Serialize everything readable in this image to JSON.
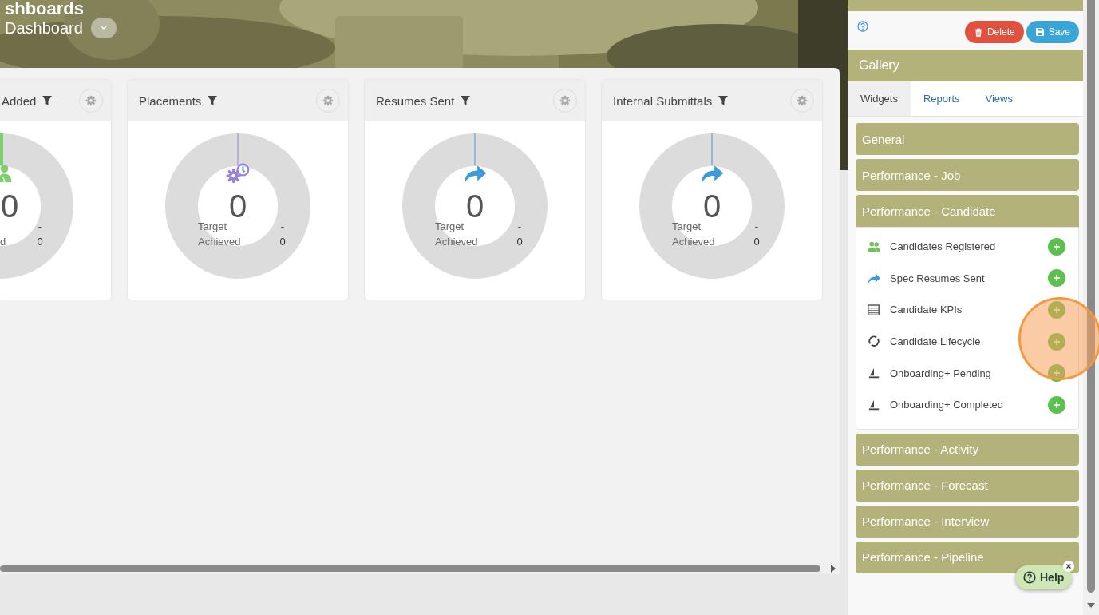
{
  "header": {
    "title": "shboards",
    "dashboard_name": "Dashboard"
  },
  "widgets": [
    {
      "title": "Added",
      "kind": "people",
      "color": "#7ccf6b",
      "value": "0",
      "target_value": "-",
      "achieved_label": "d",
      "achieved_value": "0",
      "partial": true
    },
    {
      "title": "Placements",
      "kind": "gear-clock",
      "color": "#9b7fdc",
      "value": "0",
      "target_label": "Target",
      "target_value": "-",
      "achieved_label": "Achieved",
      "achieved_value": "0",
      "partial": false
    },
    {
      "title": "Resumes Sent",
      "kind": "share-arrow",
      "color": "#3d9ad9",
      "value": "0",
      "target_label": "Target",
      "target_value": "-",
      "achieved_label": "Achieved",
      "achieved_value": "0",
      "partial": false
    },
    {
      "title": "Internal Submittals",
      "kind": "share-arrow",
      "color": "#3d9ad9",
      "value": "0",
      "target_label": "Target",
      "target_value": "-",
      "achieved_label": "Achieved",
      "achieved_value": "0",
      "partial": false
    }
  ],
  "side_panel": {
    "delete_button": "Delete",
    "save_button": "Save",
    "gallery_title": "Gallery",
    "tabs": [
      {
        "label": "Widgets",
        "selected": true
      },
      {
        "label": "Reports",
        "selected": false
      },
      {
        "label": "Views",
        "selected": false
      }
    ],
    "sections": [
      {
        "title": "General",
        "expanded": false
      },
      {
        "title": "Performance - Job",
        "expanded": false
      },
      {
        "title": "Performance - Candidate",
        "expanded": true,
        "items": [
          {
            "label": "Candidates Registered",
            "kind": "people"
          },
          {
            "label": "Spec Resumes Sent",
            "kind": "share-arrow"
          },
          {
            "label": "Candidate KPIs",
            "kind": "table"
          },
          {
            "label": "Candidate Lifecycle",
            "kind": "cycle"
          },
          {
            "label": "Onboarding+ Pending",
            "kind": "sailboat"
          },
          {
            "label": "Onboarding+ Completed",
            "kind": "sailboat"
          }
        ]
      },
      {
        "title": "Performance - Activity",
        "expanded": false
      },
      {
        "title": "Performance - Forecast",
        "expanded": false
      },
      {
        "title": "Performance - Interview",
        "expanded": false
      },
      {
        "title": "Performance - Pipeline",
        "expanded": false
      }
    ]
  },
  "help_button": "Help"
}
